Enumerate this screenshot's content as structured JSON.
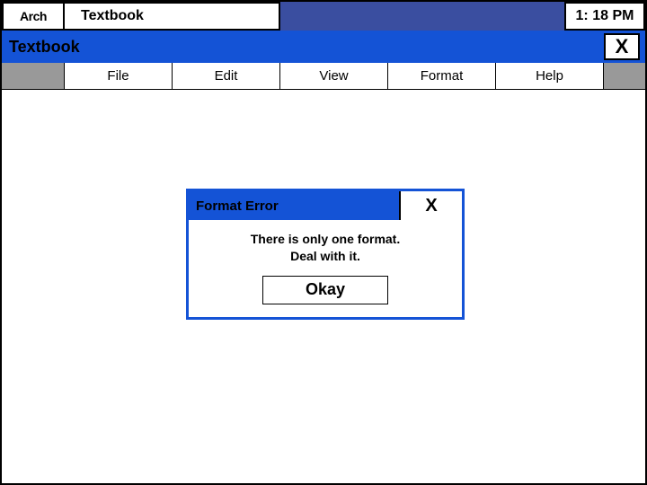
{
  "taskbar": {
    "logo_text": "Arch",
    "app_name": "Textbook",
    "clock": "1: 18 PM"
  },
  "window": {
    "title": "Textbook",
    "close_label": "X"
  },
  "menubar": {
    "items": [
      "File",
      "Edit",
      "View",
      "Format",
      "Help"
    ]
  },
  "dialog": {
    "title": "Format Error",
    "close_label": "X",
    "message": "There is only one format.\nDeal with it.",
    "ok_label": "Okay"
  }
}
